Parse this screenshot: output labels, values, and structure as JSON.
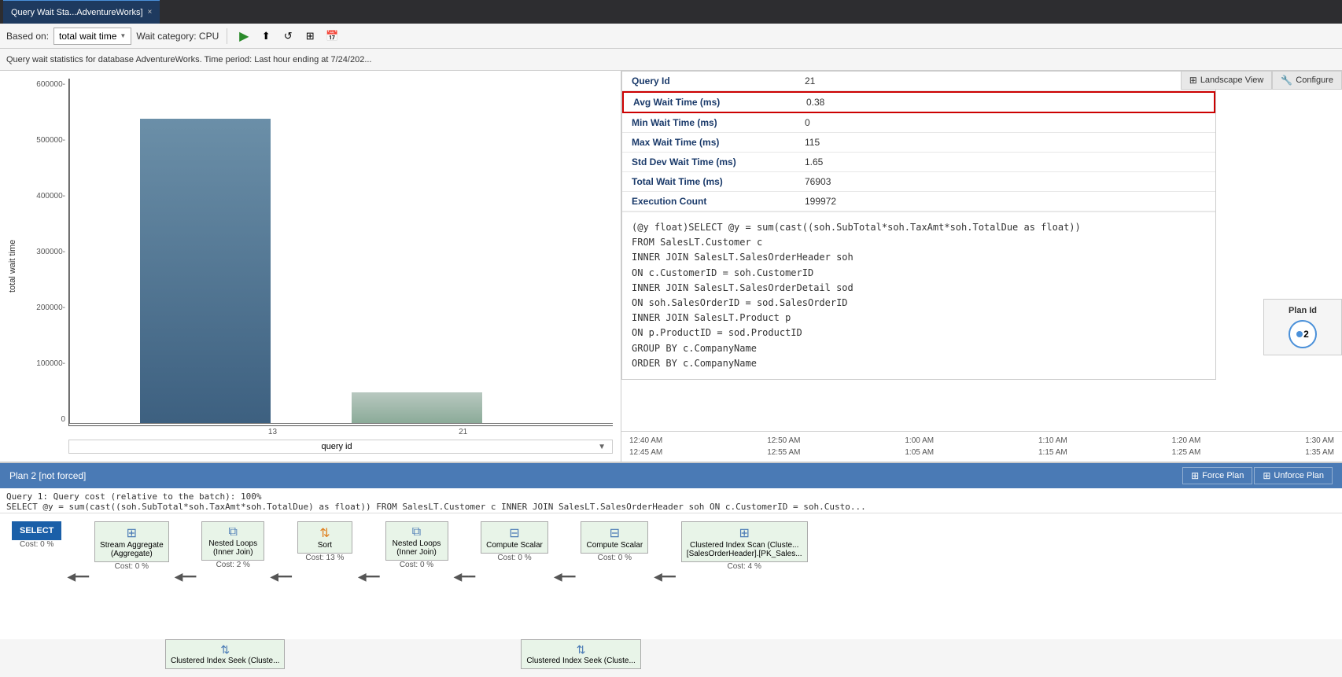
{
  "tab": {
    "title": "Query Wait Sta...AdventureWorks]",
    "close_label": "×"
  },
  "toolbar": {
    "based_on_label": "Based on:",
    "based_on_value": "total wait time",
    "wait_category_label": "Wait category: CPU"
  },
  "info_bar": {
    "text": "Query wait statistics for database AdventureWorks. Time period: Last hour ending at 7/24/202..."
  },
  "chart": {
    "y_axis_label": "total wait time",
    "y_ticks": [
      "600000-",
      "500000-",
      "400000-",
      "300000-",
      "200000-",
      "100000-",
      "0"
    ],
    "x_labels": [
      "13",
      "21"
    ],
    "x_axis_label": "query id"
  },
  "tooltip": {
    "query_id_label": "Query Id",
    "query_id_value": "21",
    "avg_wait_label": "Avg Wait Time (ms)",
    "avg_wait_value": "0.38",
    "min_wait_label": "Min Wait Time (ms)",
    "min_wait_value": "0",
    "max_wait_label": "Max Wait Time (ms)",
    "max_wait_value": "115",
    "std_dev_label": "Std Dev Wait Time (ms)",
    "std_dev_value": "1.65",
    "total_wait_label": "Total Wait Time (ms)",
    "total_wait_value": "76903",
    "exec_count_label": "Execution Count",
    "exec_count_value": "199972",
    "query_text": "(@y float)SELECT @y = sum(cast((soh.SubTotal*soh.TaxAmt*soh.TotalDue as float))\nFROM SalesLT.Customer c\nINNER JOIN SalesLT.SalesOrderHeader soh\nON c.CustomerID = soh.CustomerID\nINNER JOIN SalesLT.SalesOrderDetail sod\nON soh.SalesOrderID = sod.SalesOrderID\nINNER JOIN SalesLT.Product p\nON p.ProductID = sod.ProductID\nGROUP BY c.CompanyName\nORDER BY c.CompanyName"
  },
  "time_axis": {
    "row1": [
      "12:40 AM",
      "12:50 AM",
      "1:00 AM",
      "1:10 AM",
      "1:20 AM",
      "1:30 AM"
    ],
    "row2": [
      "12:45 AM",
      "12:55 AM",
      "1:05 AM",
      "1:15 AM",
      "1:25 AM",
      "1:35 AM"
    ]
  },
  "plan_id": {
    "label": "Plan Id",
    "value": "2",
    "badge": "⬤2"
  },
  "top_right_buttons": {
    "landscape_view": "Landscape View",
    "configure": "Configure"
  },
  "plan_bar": {
    "label": "Plan 2 [not forced]",
    "force_plan": "Force Plan",
    "unforce_plan": "Unforce Plan"
  },
  "query_text": "Query 1: Query cost (relative to the batch): 100%",
  "query_sql": "SELECT @y = sum(cast((soh.SubTotal*soh.TaxAmt*soh.TotalDue) as float)) FROM SalesLT.Customer c INNER JOIN SalesLT.SalesOrderHeader soh ON c.CustomerID = soh.Custo...",
  "execution_plan": {
    "nodes": [
      {
        "id": "select",
        "label": "SELECT",
        "cost": "Cost: 0 %",
        "selected": true
      },
      {
        "id": "stream-aggregate",
        "label": "Stream Aggregate\n(Aggregate)",
        "cost": "Cost: 0 %"
      },
      {
        "id": "nested-loops-1",
        "label": "Nested Loops\n(Inner Join)",
        "cost": "Cost: 2 %"
      },
      {
        "id": "sort",
        "label": "Sort",
        "cost": "Cost: 13 %"
      },
      {
        "id": "nested-loops-2",
        "label": "Nested Loops\n(Inner Join)",
        "cost": "Cost: 0 %"
      },
      {
        "id": "compute-scalar-1",
        "label": "Compute Scalar",
        "cost": "Cost: 0 %"
      },
      {
        "id": "compute-scalar-2",
        "label": "Compute Scalar",
        "cost": "Cost: 0 %"
      },
      {
        "id": "clustered-index-scan",
        "label": "Clustered Index Scan (Cluste...\n[SalesOrderHeader].[PK_Sales...",
        "cost": "Cost: 4 %"
      }
    ],
    "bottom_nodes": [
      {
        "id": "clustered-index-seek-1",
        "label": "Clustered Index Seek (Cluste...",
        "cost": ""
      },
      {
        "id": "clustered-index-seek-2",
        "label": "Clustered Index Seek (Cluste...",
        "cost": ""
      }
    ]
  }
}
